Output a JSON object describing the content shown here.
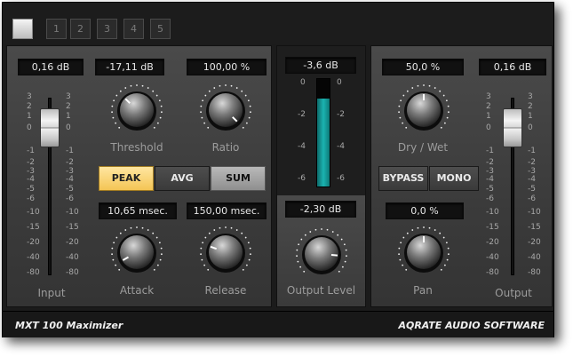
{
  "presets": [
    "",
    "1",
    "2",
    "3",
    "4",
    "5"
  ],
  "left": {
    "input_db": "0,16 dB",
    "threshold": "-17,11 dB",
    "ratio": "100,00 %",
    "threshold_label": "Threshold",
    "ratio_label": "Ratio",
    "modes": [
      "PEAK",
      "AVG",
      "SUM"
    ],
    "attack": "10,65 msec.",
    "release": "150,00 msec.",
    "attack_label": "Attack",
    "release_label": "Release",
    "input_label": "Input"
  },
  "middle": {
    "meter_db": "-3,6 dB",
    "output_level": "-2,30 dB",
    "output_level_label": "Output Level",
    "meter_scale": [
      "0",
      "-2",
      "-4",
      "-6"
    ]
  },
  "right": {
    "drywet": "50,0 %",
    "drywet_label": "Dry / Wet",
    "output_db": "0,16 dB",
    "buttons": [
      "BYPASS",
      "MONO"
    ],
    "pan": "0,0 %",
    "pan_label": "Pan",
    "output_label": "Output"
  },
  "fader_scale": [
    "3",
    "2",
    "1",
    "0",
    "-1",
    "-2",
    "-3",
    "-4",
    "-5",
    "-6",
    "-8",
    "-10",
    "-15",
    "-20",
    "-30",
    "-40",
    "-50",
    "-80"
  ],
  "footer": {
    "product": "MXT 100 Maximizer",
    "company": "AQRATE AUDIO SOFTWARE"
  },
  "colors": {
    "accent_active": "#f4c555",
    "meter": "#1bb3b0"
  }
}
